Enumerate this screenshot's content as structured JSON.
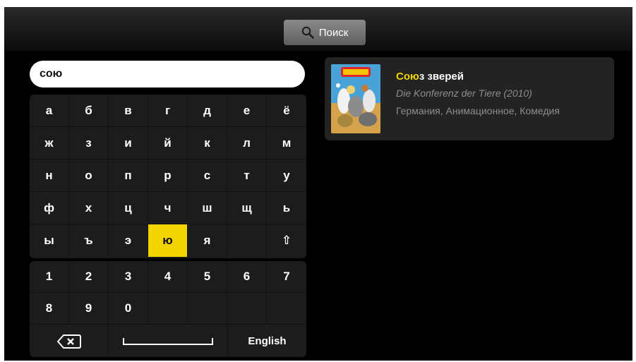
{
  "header": {
    "search_label": "Поиск",
    "search_icon": "magnifier-icon"
  },
  "query": {
    "value": "сою"
  },
  "keyboard": {
    "letter_rows": [
      [
        "а",
        "б",
        "в",
        "г",
        "д",
        "е",
        "ё"
      ],
      [
        "ж",
        "з",
        "и",
        "й",
        "к",
        "л",
        "м"
      ],
      [
        "н",
        "о",
        "п",
        "р",
        "с",
        "т",
        "у"
      ],
      [
        "ф",
        "х",
        "ц",
        "ч",
        "ш",
        "щ",
        "ь"
      ],
      [
        "ы",
        "ъ",
        "э",
        "ю",
        "я",
        "",
        "⇧"
      ]
    ],
    "selected_key": "ю",
    "digit_rows": [
      [
        "1",
        "2",
        "3",
        "4",
        "5",
        "6",
        "7"
      ],
      [
        "8",
        "9",
        "0",
        "",
        "",
        "",
        ""
      ]
    ],
    "backspace_icon": "backspace-icon",
    "space_icon": "space-bar-icon",
    "language_label": "English"
  },
  "results": [
    {
      "title_match": "Сою",
      "title_rest": "з зверей",
      "original_title": "Die Konferenz der Tiere (2010)",
      "genres": "Германия, Анимационное, Комедия",
      "poster_icon": "movie-poster-thumbnail"
    }
  ],
  "colors": {
    "accent": "#f2d400",
    "background": "#000000",
    "panel": "#1c1c1c",
    "card": "#232323"
  }
}
